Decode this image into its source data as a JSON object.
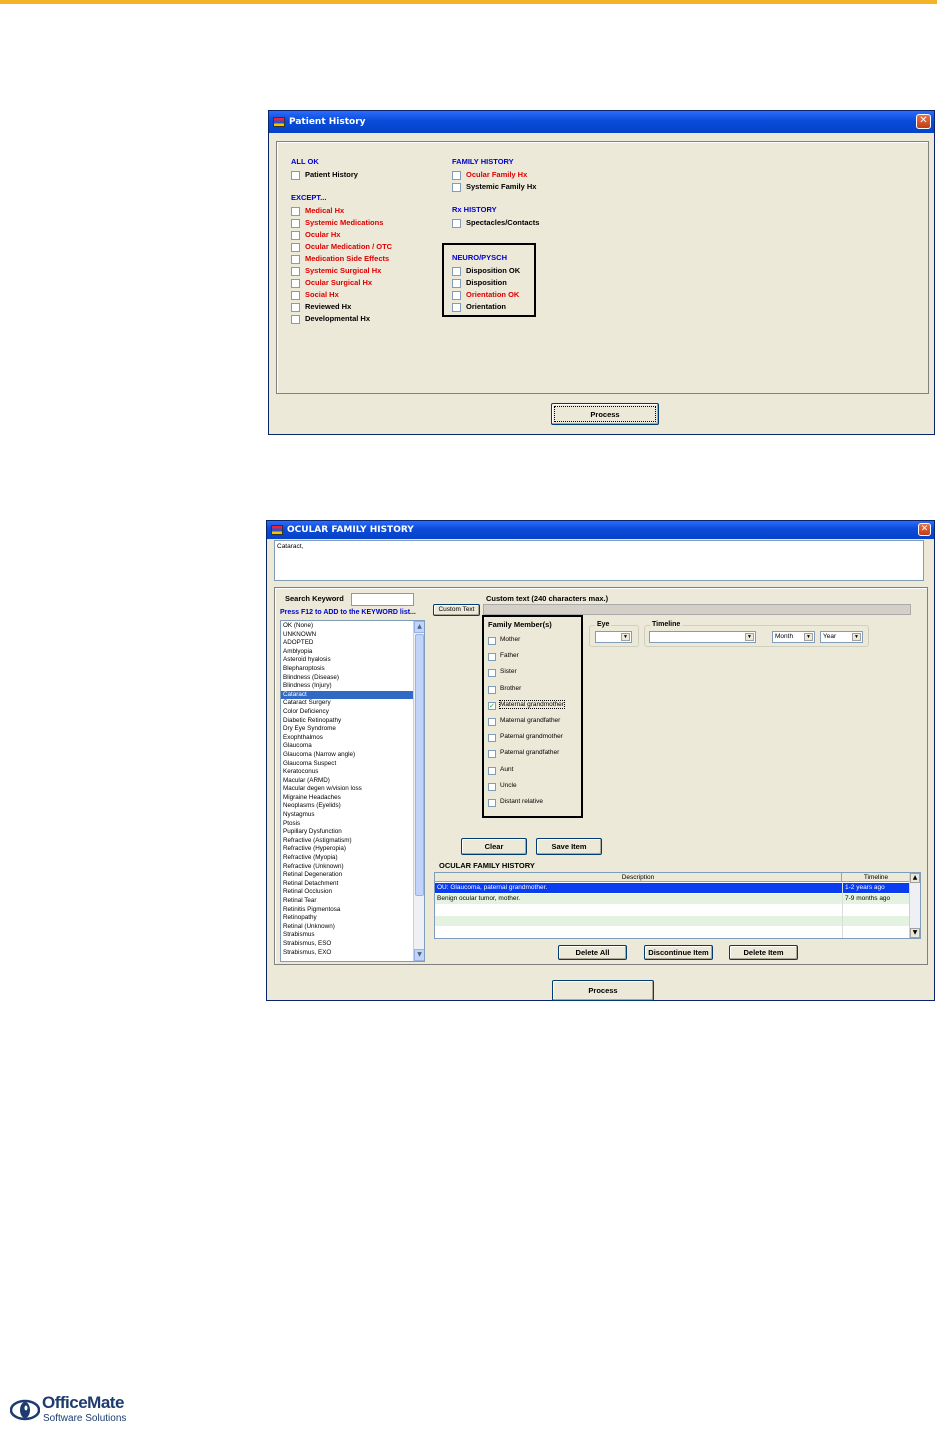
{
  "dialog1": {
    "title": "Patient History",
    "all_ok_header": "ALL OK",
    "all_ok_items": [
      "Patient History"
    ],
    "except_header": "EXCEPT...",
    "except_items": [
      {
        "label": "Medical Hx",
        "color": "red"
      },
      {
        "label": "Systemic Medications",
        "color": "red"
      },
      {
        "label": "Ocular Hx",
        "color": "red"
      },
      {
        "label": "Ocular Medication / OTC",
        "color": "red"
      },
      {
        "label": "Medication Side Effects",
        "color": "red"
      },
      {
        "label": "Systemic Surgical Hx",
        "color": "red"
      },
      {
        "label": "Ocular Surgical Hx",
        "color": "red"
      },
      {
        "label": "Social Hx",
        "color": "red"
      },
      {
        "label": "Reviewed Hx",
        "color": "black"
      },
      {
        "label": "Developmental Hx",
        "color": "black"
      }
    ],
    "family_header": "FAMILY HISTORY",
    "family_items": [
      {
        "label": "Ocular Family Hx",
        "color": "red"
      },
      {
        "label": "Systemic Family Hx",
        "color": "black"
      }
    ],
    "rx_header": "Rx HISTORY",
    "rx_items": [
      {
        "label": "Spectacles/Contacts",
        "color": "black"
      }
    ],
    "neuro_header": "NEURO/PYSCH",
    "neuro_items": [
      {
        "label": "Disposition OK",
        "color": "black"
      },
      {
        "label": "Disposition",
        "color": "black"
      },
      {
        "label": "Orientation OK",
        "color": "red"
      },
      {
        "label": "Orientation",
        "color": "black"
      }
    ],
    "process_label": "Process"
  },
  "dialog2": {
    "title": "OCULAR FAMILY HISTORY",
    "text_area": "Cataract,",
    "search_label": "Search Keyword",
    "search_value": "",
    "f12_hint": "Press F12 to ADD to the KEYWORD list...",
    "custom_text_header": "Custom text (240 characters max.)",
    "custom_text_button": "Custom Text",
    "keywords": [
      "OK (None)",
      "UNKNOWN",
      "ADOPTED",
      "Amblyopia",
      "Asteroid hyalosis",
      "Blepharoptosis",
      "Blindness (Disease)",
      "Blindness (Injury)",
      "Cataract",
      "Cataract Surgery",
      "Color Deficiency",
      "Diabetic Retinopathy",
      "Dry Eye Syndrome",
      "Exophthalmos",
      "Glaucoma",
      "Glaucoma (Narrow angle)",
      "Glaucoma Suspect",
      "Keratoconus",
      "Macular (ARMD)",
      "Macular degen w/vision loss",
      "Migraine Headaches",
      "Neoplasms (Eyelids)",
      "Nystagmus",
      "Ptosis",
      "Pupillary Dysfunction",
      "Refractive (Astigmatism)",
      "Refractive (Hyperopia)",
      "Refractive (Myopia)",
      "Refractive (Unknown)",
      "Retinal Degeneration",
      "Retinal Detachment",
      "Retinal Occlusion",
      "Retinal Tear",
      "Retinitis Pigmentosa",
      "Retinopathy",
      "Retinal (Unknown)",
      "Strabismus",
      "Strabismus, ESO",
      "Strabismus, EXO"
    ],
    "selected_keyword": "Cataract",
    "family_group_label": "Family Member(s)",
    "family_members": [
      {
        "label": "Mother",
        "checked": false
      },
      {
        "label": "Father",
        "checked": false
      },
      {
        "label": "Sister",
        "checked": false
      },
      {
        "label": "Brother",
        "checked": false
      },
      {
        "label": "Maternal grandmother",
        "checked": true
      },
      {
        "label": "Maternal grandfather",
        "checked": false
      },
      {
        "label": "Paternal grandmother",
        "checked": false
      },
      {
        "label": "Paternal grandfather",
        "checked": false
      },
      {
        "label": "Aunt",
        "checked": false
      },
      {
        "label": "Uncle",
        "checked": false
      },
      {
        "label": "Distant relative",
        "checked": false
      }
    ],
    "eye_label": "Eye",
    "eye_value": "",
    "timeline_label": "Timeline",
    "timeline_value": "",
    "month_value": "Month",
    "year_value": "Year",
    "clear_label": "Clear",
    "save_label": "Save Item",
    "history_header": "OCULAR FAMILY HISTORY",
    "col_description": "Description",
    "col_timeline": "Timeline",
    "history_rows": [
      {
        "description": "OU: Glaucoma, paternal grandmother.",
        "timeline": "1-2 years ago",
        "selected": true
      },
      {
        "description": "Benign ocular tumor, mother.",
        "timeline": "7-9 months ago",
        "selected": false
      }
    ],
    "delete_all_label": "Delete All",
    "discontinue_label": "Discontinue Item",
    "delete_item_label": "Delete Item",
    "process_label": "Process"
  },
  "footer": {
    "logo_name": "OfficeMate",
    "logo_sub": "Software Solutions"
  },
  "colors": {
    "accent_bar": "#f5b325",
    "header_blue": "#0000cc",
    "required_red": "#dd0000",
    "selection_blue": "#316ac5"
  }
}
